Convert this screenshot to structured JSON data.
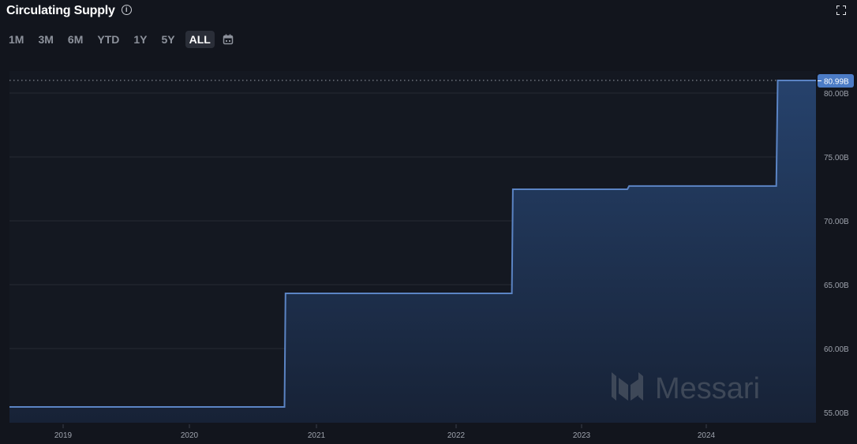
{
  "header": {
    "title": "Circulating Supply",
    "info_icon": "info-icon",
    "expand_icon": "fullscreen-icon"
  },
  "time_ranges": {
    "options": [
      "1M",
      "3M",
      "6M",
      "YTD",
      "1Y",
      "5Y",
      "ALL"
    ],
    "selected": "ALL",
    "calendar_icon": "calendar-icon"
  },
  "watermark": {
    "text": "Messari",
    "icon": "messari-logo-icon"
  },
  "colors": {
    "line": "#5b84c4",
    "area_top": "#26426c",
    "area_bottom": "#172236",
    "last_value_badge": "#4c7cc6",
    "background": "#12151d",
    "grid": "#262a33"
  },
  "chart_data": {
    "type": "area",
    "style": "step",
    "title": "Circulating Supply",
    "xlabel": "",
    "ylabel": "",
    "x_ticks": [
      "2019",
      "2020",
      "2021",
      "2022",
      "2023",
      "2024"
    ],
    "y_ticks": [
      "55.00B",
      "60.00B",
      "65.00B",
      "70.00B",
      "75.00B",
      "80.00B"
    ],
    "ylim": [
      54.6,
      81.5
    ],
    "xlim": [
      "2018-07",
      "2024-11"
    ],
    "grid": true,
    "last_value_label": "80.99B",
    "points": [
      {
        "date": "2018-07-30",
        "value": 55.43
      },
      {
        "date": "2020-10-01",
        "value": 55.43
      },
      {
        "date": "2020-10-04",
        "value": 64.32
      },
      {
        "date": "2022-06-12",
        "value": 64.32
      },
      {
        "date": "2022-06-15",
        "value": 72.47
      },
      {
        "date": "2023-05-15",
        "value": 72.47
      },
      {
        "date": "2023-05-20",
        "value": 72.72
      },
      {
        "date": "2024-07-22",
        "value": 72.72
      },
      {
        "date": "2024-07-26",
        "value": 80.99
      },
      {
        "date": "2024-11-10",
        "value": 80.99
      }
    ],
    "series": [
      {
        "name": "Circulating Supply (B)",
        "values": [
          55.43,
          55.43,
          64.32,
          64.32,
          72.47,
          72.47,
          72.72,
          72.72,
          80.99,
          80.99
        ]
      }
    ]
  }
}
